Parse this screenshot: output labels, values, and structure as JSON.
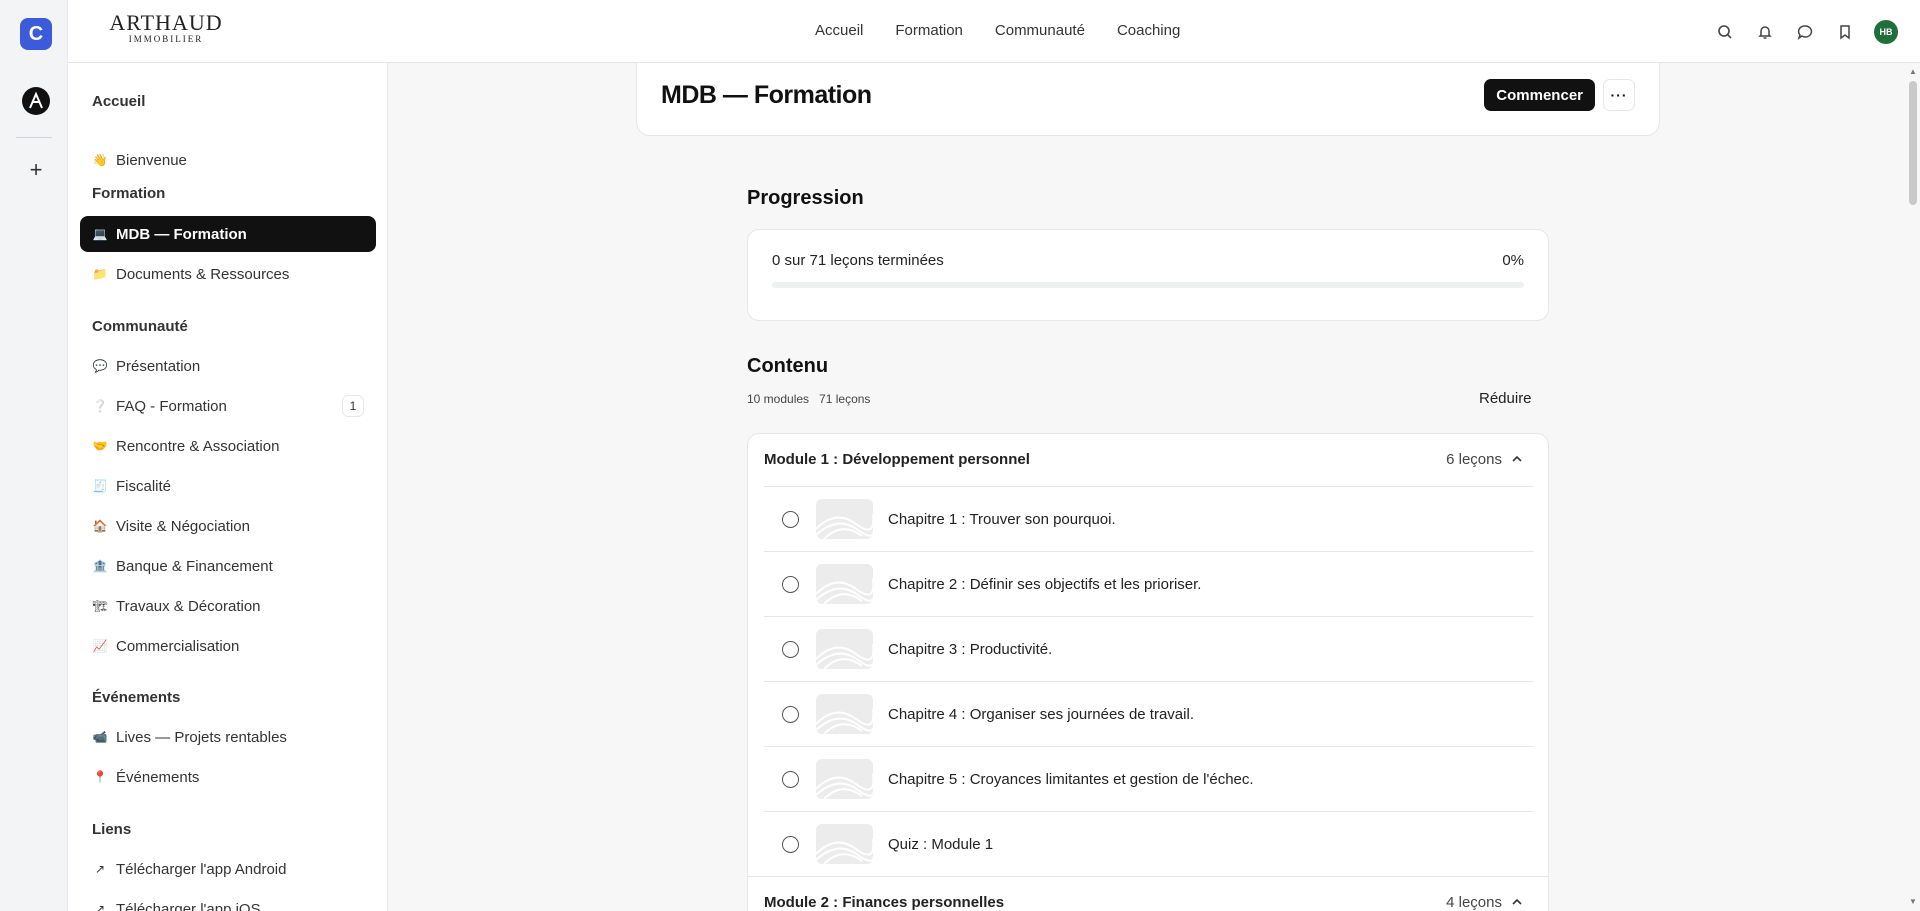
{
  "rail": {
    "app1_letter": "C"
  },
  "brand": {
    "name": "ARTHAUD",
    "sub": "IMMOBILIER"
  },
  "topnav": [
    "Accueil",
    "Formation",
    "Communauté",
    "Coaching"
  ],
  "user": {
    "initials": "HB"
  },
  "sidebar": {
    "sections": [
      {
        "title": "Accueil",
        "items": [
          {
            "emoji": "👋",
            "label": "Bienvenue"
          }
        ]
      },
      {
        "title": "Formation",
        "items": [
          {
            "emoji": "💻",
            "label": "MDB — Formation",
            "active": true
          },
          {
            "emoji": "📁",
            "label": "Documents & Ressources"
          }
        ]
      },
      {
        "title": "Communauté",
        "items": [
          {
            "emoji": "💬",
            "label": "Présentation"
          },
          {
            "emoji": "❔",
            "label": "FAQ - Formation",
            "badge": "1"
          },
          {
            "emoji": "🤝",
            "label": "Rencontre & Association"
          },
          {
            "emoji": "🧾",
            "label": "Fiscalité"
          },
          {
            "emoji": "🏠",
            "label": "Visite & Négociation"
          },
          {
            "emoji": "🏦",
            "label": "Banque & Financement"
          },
          {
            "emoji": "🏗",
            "label": "Travaux & Décoration"
          },
          {
            "emoji": "📈",
            "label": "Commercialisation"
          }
        ]
      },
      {
        "title": "Événements",
        "items": [
          {
            "emoji": "📹",
            "label": "Lives — Projets rentables"
          },
          {
            "emoji": "📍",
            "label": "Événements"
          }
        ]
      },
      {
        "title": "Liens",
        "items": [
          {
            "emoji": "↗",
            "label": "Télécharger l'app Android"
          },
          {
            "emoji": "↗",
            "label": "Télécharger l'app iOS"
          }
        ]
      }
    ]
  },
  "course": {
    "title": "MDB — Formation",
    "start_label": "Commencer",
    "more_label": "···"
  },
  "progress": {
    "heading": "Progression",
    "text": "0 sur 71 leçons terminées",
    "percent_label": "0%",
    "fraction": 0
  },
  "content": {
    "heading": "Contenu",
    "modules_count": "10 modules",
    "lessons_count": "71 leçons",
    "collapse_label": "Réduire",
    "modules": [
      {
        "name": "Module 1 : Développement personnel",
        "count": "6 leçons",
        "lessons": [
          "Chapitre 1 : Trouver son pourquoi.",
          "Chapitre 2 : Définir ses objectifs et les prioriser.",
          "Chapitre 3 : Productivité.",
          "Chapitre 4 : Organiser ses journées de travail.",
          "Chapitre 5 : Croyances limitantes et gestion de l'échec.",
          "Quiz : Module 1"
        ]
      },
      {
        "name": "Module 2 : Finances personnelles",
        "count": "4 leçons",
        "lessons": []
      }
    ]
  }
}
